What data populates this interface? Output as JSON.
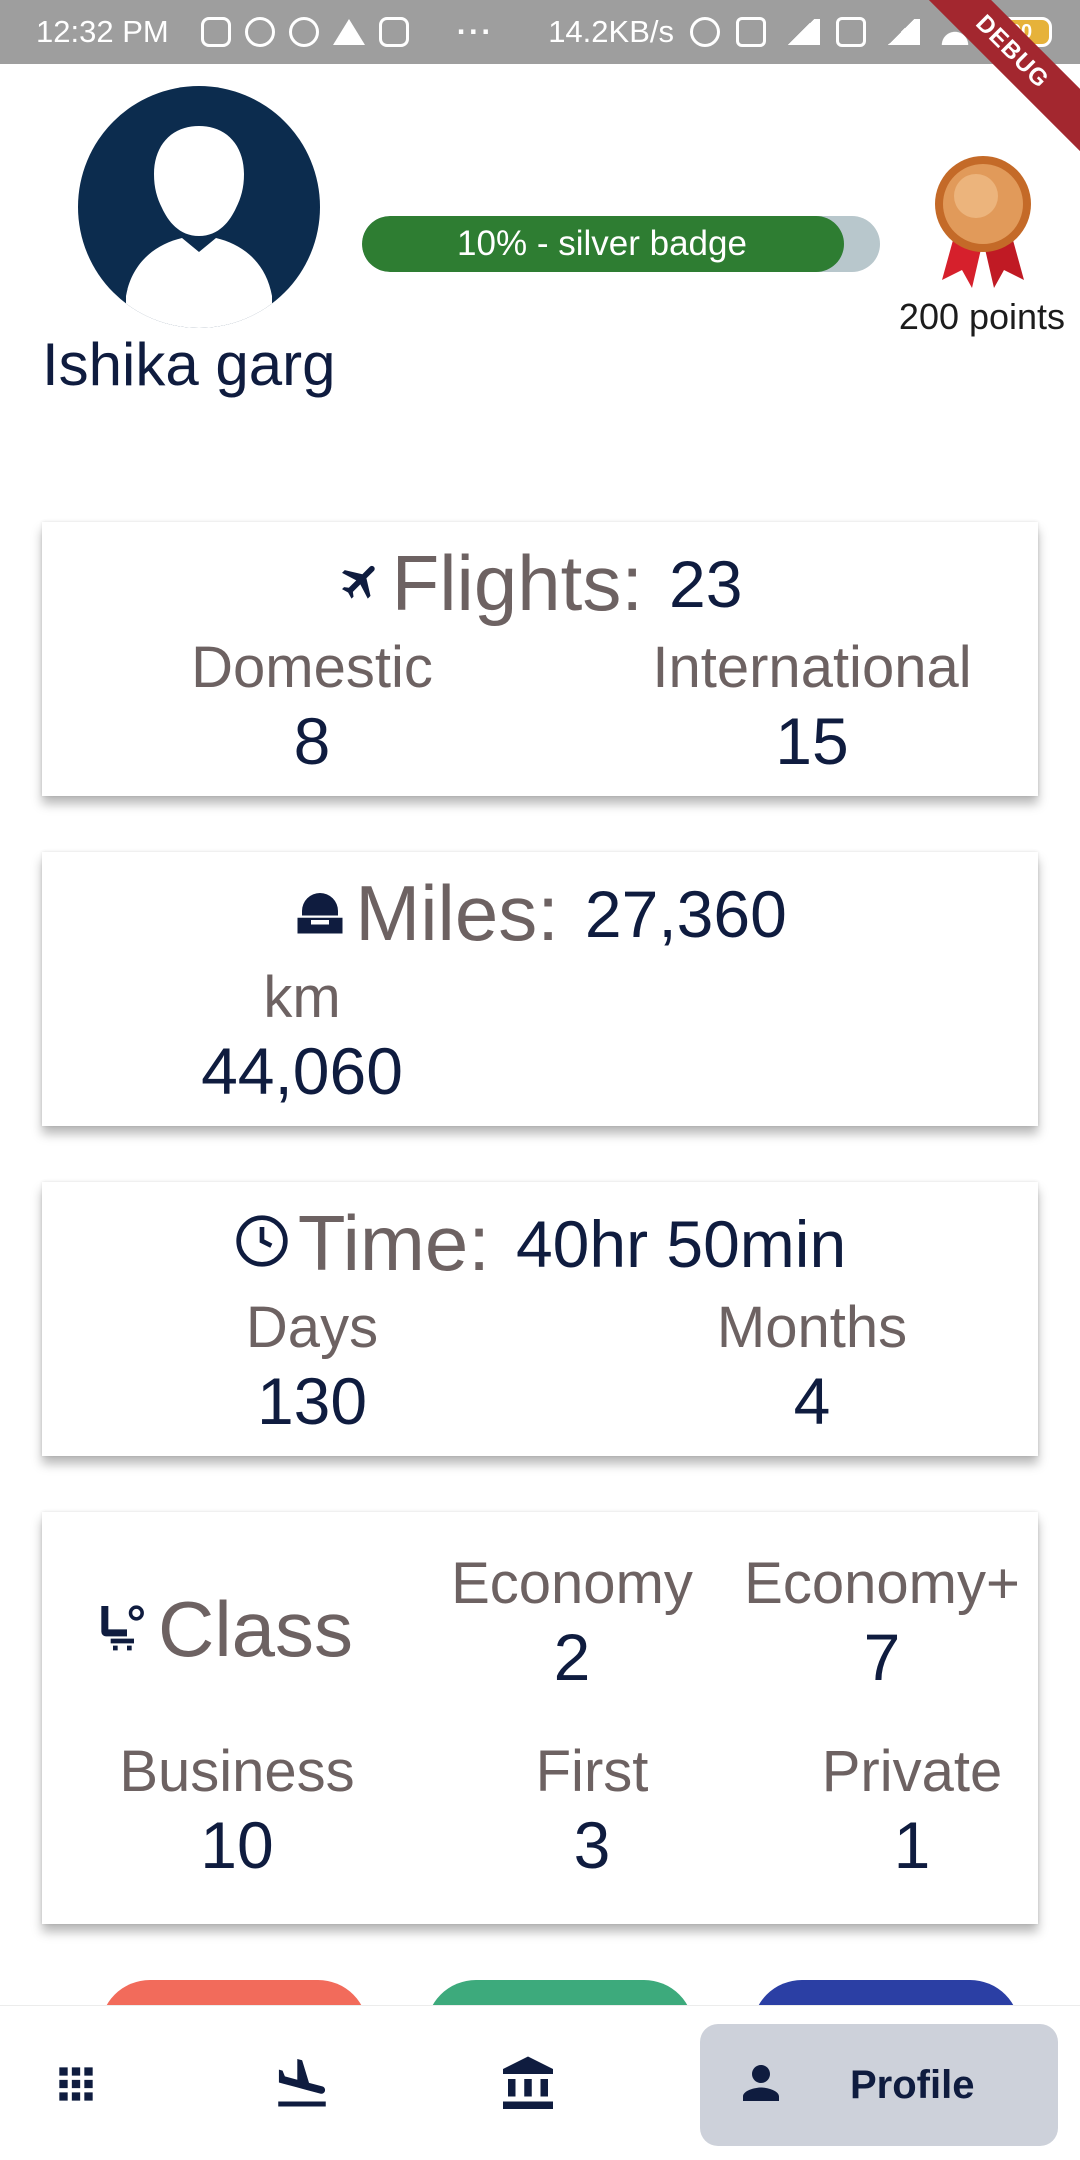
{
  "status_bar": {
    "time": "12:32 PM",
    "network_speed": "14.2KB/s",
    "battery": "90",
    "more": "···"
  },
  "debug_banner": "DEBUG",
  "profile": {
    "name": "Ishika garg",
    "progress_label": "10% - silver badge",
    "progress_value": 0.1,
    "points": "200 points",
    "avatar_color": "#0c2c4e"
  },
  "flights": {
    "icon": "airplane-icon",
    "label": "Flights:",
    "value": "23",
    "stats": [
      {
        "label": "Domestic",
        "value": "8"
      },
      {
        "label": "International",
        "value": "15"
      }
    ]
  },
  "miles": {
    "icon": "cabin-icon",
    "label": "Miles:",
    "value": "27,360",
    "stats": [
      {
        "label": "km",
        "value": "44,060"
      }
    ]
  },
  "time": {
    "icon": "clock-icon",
    "label": "Time:",
    "value": "40hr 50min",
    "stats": [
      {
        "label": "Days",
        "value": "130"
      },
      {
        "label": "Months",
        "value": "4"
      }
    ]
  },
  "class": {
    "icon": "seat-icon",
    "label": "Class",
    "stats": [
      {
        "label": "Economy",
        "value": "2"
      },
      {
        "label": "Economy+",
        "value": "7"
      },
      {
        "label": "Business",
        "value": "10"
      },
      {
        "label": "First",
        "value": "3"
      },
      {
        "label": "Private",
        "value": "1"
      }
    ]
  },
  "pills": [
    {
      "color": "#f26b5b"
    },
    {
      "color": "#3daa7c"
    },
    {
      "color": "#2b3fa4"
    }
  ],
  "bottom_nav": {
    "items": [
      {
        "icon": "grid-icon"
      },
      {
        "icon": "flight-land-icon"
      },
      {
        "icon": "bank-icon"
      }
    ],
    "active_label": "Profile",
    "active_icon": "person-icon"
  },
  "colors": {
    "accent_green": "#2e7d32",
    "label_grey": "#6d6262",
    "value_navy": "#0f1c3f",
    "nav_active_bg": "#cdd1da"
  }
}
